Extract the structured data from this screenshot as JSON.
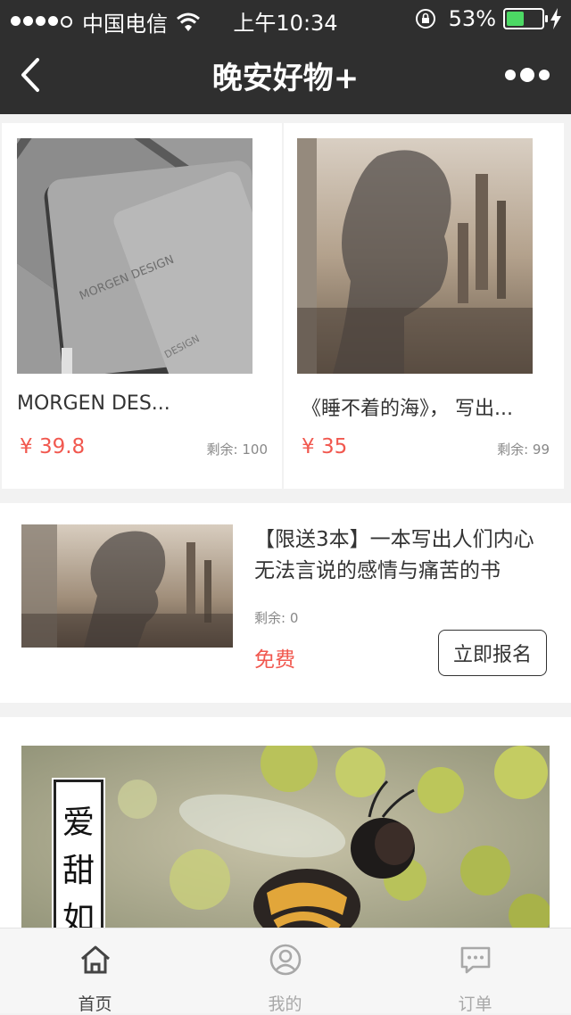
{
  "status_bar": {
    "carrier": "中国电信",
    "time": "上午10:34",
    "battery_percent": "53%",
    "battery_level": 0.53,
    "signal_bars": 4,
    "icons": [
      "signal-dots-icon",
      "wifi-icon",
      "rotation-lock-icon",
      "battery-icon",
      "charging-bolt-icon"
    ]
  },
  "nav": {
    "title": "晚安好物+",
    "back_icon": "chevron-left-icon",
    "more_icon": "more-dots-icon"
  },
  "products": [
    {
      "name": "MORGEN DES...",
      "price": "¥ 39.8",
      "stock": "剩余: 100",
      "image_text": "MORGEN DESIGN"
    },
    {
      "name": "《睡不着的海》， 写出...",
      "price": "¥ 35",
      "stock": "剩余: 99"
    }
  ],
  "feature": {
    "title": "【限送3本】一本写出人们内心无法言说的感情与痛苦的书",
    "stock": "剩余: 0",
    "price": "免费",
    "button_label": "立即报名"
  },
  "banner": {
    "vertical_text": [
      "爱",
      "甜",
      "如"
    ]
  },
  "tabs": [
    {
      "label": "首页",
      "icon": "home-icon",
      "active": true
    },
    {
      "label": "我的",
      "icon": "user-icon",
      "active": false
    },
    {
      "label": "订单",
      "icon": "message-icon",
      "active": false
    }
  ],
  "colors": {
    "bar_bg": "#2f2f2f",
    "price_red": "#f1584f",
    "battery_green": "#4cd964",
    "tab_active": "#444444",
    "tab_inactive": "#a8a8a8"
  }
}
